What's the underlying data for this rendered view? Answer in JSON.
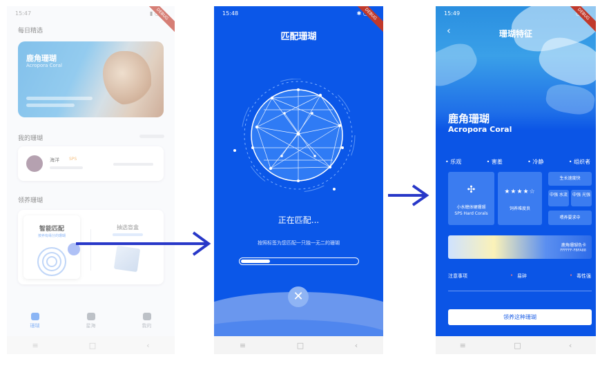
{
  "phone1": {
    "status_time": "15:47",
    "daily_pick_title": "每日精选",
    "banner_name_cn": "鹿角珊瑚",
    "banner_name_en": "Acropora Coral",
    "my_coral_title": "我的珊瑚",
    "card1_name": "海洋",
    "card1_tag": "SPS",
    "adopt_title": "领养珊瑚",
    "smart_match_title": "智能匹配",
    "smart_match_sub": "按养有缘分的珊瑚",
    "blind_box_title": "抽选盲盒",
    "tabs": [
      "珊瑚",
      "星海",
      "我的"
    ]
  },
  "phone2": {
    "status_time": "15:48",
    "title": "匹配珊瑚",
    "status_text": "正在匹配...",
    "hint": "按照标签为您匹配一只独一无二的珊瑚",
    "progress": 0.25,
    "close_glyph": "✕",
    "ribbon": "DEBUG"
  },
  "phone3": {
    "status_time": "15:49",
    "title": "珊瑚特征",
    "back_glyph": "‹",
    "name_cn": "鹿角珊瑚",
    "name_en": "Acropora Coral",
    "traits": [
      "• 乐观",
      "• 害羞",
      "• 冷静",
      "• 组织者"
    ],
    "type_label": "小水螅体硬珊瑚",
    "type_label_en": "SPS Hard Corals",
    "stars": "★★★★☆",
    "difficulty_label": "饲养难度良",
    "growth": "生长速度快",
    "flow_label": "中强 水流",
    "light_label": "中强 光强",
    "feeding": "喂养要求中",
    "color_card_title": "鹿角珊瑚色卡",
    "color_codes": "FFFFFF-FBFA88",
    "notes_label": "注意事项",
    "note1": "易碎",
    "note2": "毒性强",
    "adopt_button": "领养这种珊瑚",
    "ribbon": "DEBUG"
  },
  "nav_glyphs": [
    "≡",
    "□",
    "‹"
  ],
  "colors": {
    "primary_blue": "#0b57e8",
    "arrow": "#2838c8"
  }
}
